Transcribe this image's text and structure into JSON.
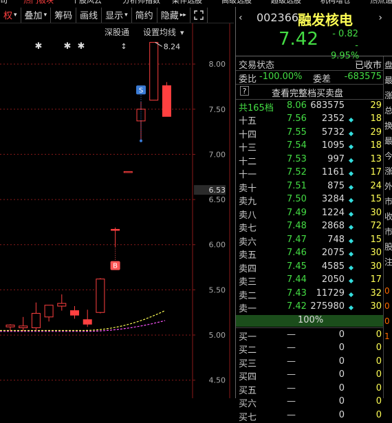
{
  "top_strip": [
    "司",
    "热门板块",
    "个股风云",
    "分析师指数",
    "某伴选股",
    "高级选股",
    "超级选股",
    "机构增仓",
    "热点追"
  ],
  "toolbar": {
    "items": [
      {
        "label": "权",
        "arrow": true,
        "color": "#ff4040"
      },
      {
        "label": "叠加",
        "arrow": true
      },
      {
        "label": "筹码"
      },
      {
        "label": "画线"
      },
      {
        "label": "显示",
        "arrow": true
      },
      {
        "label": "简约"
      },
      {
        "label": "隐藏",
        "arrow": "▸▸"
      },
      {
        "label": "fullscreen-icon"
      }
    ]
  },
  "chart": {
    "top_labels": {
      "shengu": "深股通",
      "ma_setting": "设置均线",
      "ma_arrow": "▾"
    },
    "price_axis": [
      "8.00",
      "7.50",
      "7.00",
      "6.50",
      "6.00",
      "5.50",
      "5.00",
      "4.50"
    ],
    "current_price_tag": "6.53",
    "high_label": "8.24",
    "markers": {
      "s": "S",
      "b": "B"
    },
    "colors": {
      "up": "#ff4040",
      "down": "#22cccc",
      "ma5": "#ffffff",
      "ma10": "#ffff55",
      "ma20": "#ff55ff",
      "grid": "#8b1a1a"
    }
  },
  "chart_data": {
    "type": "candlestick",
    "ylim": [
      4.3,
      8.45
    ],
    "candles": [
      {
        "o": 5.09,
        "h": 5.12,
        "l": 5.04,
        "c": 5.11
      },
      {
        "o": 5.08,
        "h": 5.2,
        "l": 5.04,
        "c": 5.1
      },
      {
        "o": 5.08,
        "h": 5.36,
        "l": 5.05,
        "c": 5.24
      },
      {
        "o": 5.2,
        "h": 5.28,
        "l": 5.15,
        "c": 5.33
      },
      {
        "o": 5.32,
        "h": 5.45,
        "l": 5.27,
        "c": 5.35
      },
      {
        "o": 5.27,
        "h": 5.32,
        "l": 5.18,
        "c": 5.22
      },
      {
        "o": 5.17,
        "h": 5.28,
        "l": 5.09,
        "c": 5.12
      },
      {
        "o": 5.25,
        "h": 5.63,
        "l": 5.24,
        "c": 5.62
      },
      {
        "o": 6.17,
        "h": 6.19,
        "l": 5.97,
        "c": 6.16
      },
      {
        "o": 6.81,
        "h": 6.81,
        "l": 6.81,
        "c": 6.81
      },
      {
        "o": 7.37,
        "h": 7.58,
        "l": 7.15,
        "c": 7.5
      },
      {
        "o": 7.6,
        "h": 8.24,
        "l": 7.6,
        "c": 8.24
      },
      {
        "o": 7.76,
        "h": 7.8,
        "l": 7.42,
        "c": 7.42
      }
    ]
  },
  "quote": {
    "nav_left": "‹",
    "code": "002366",
    "name": "融发核电",
    "nav_right": "›",
    "price": "7.42",
    "change": "- 0.82",
    "change_pct": "- 9.95%",
    "status_label": "交易状态",
    "status_value": "已收市",
    "ratio_label": "委比",
    "ratio_value": "-100.00%",
    "diff_label": "委差",
    "diff_value": "-683575",
    "full_book_button": "查看完整档买卖盘",
    "help_icon": "?",
    "total_label": "共165档",
    "total_price": "8.06",
    "total_vol": "683575",
    "total_cnt": "29",
    "progress_label": "100%",
    "progress_value": 1.0
  },
  "asks": [
    {
      "label": "十五",
      "price": "7.56",
      "vol": "2352",
      "cnt": "18"
    },
    {
      "label": "十四",
      "price": "7.55",
      "vol": "5732",
      "cnt": "29"
    },
    {
      "label": "十三",
      "price": "7.54",
      "vol": "1095",
      "cnt": "18"
    },
    {
      "label": "十二",
      "price": "7.53",
      "vol": "997",
      "cnt": "13"
    },
    {
      "label": "十一",
      "price": "7.52",
      "vol": "1161",
      "cnt": "17"
    },
    {
      "label": "卖十",
      "price": "7.51",
      "vol": "875",
      "cnt": "24"
    },
    {
      "label": "卖九",
      "price": "7.50",
      "vol": "3284",
      "cnt": "15"
    },
    {
      "label": "卖八",
      "price": "7.49",
      "vol": "1224",
      "cnt": "30"
    },
    {
      "label": "卖七",
      "price": "7.48",
      "vol": "2868",
      "cnt": "72"
    },
    {
      "label": "卖六",
      "price": "7.47",
      "vol": "748",
      "cnt": "15"
    },
    {
      "label": "卖五",
      "price": "7.46",
      "vol": "2075",
      "cnt": "30"
    },
    {
      "label": "卖四",
      "price": "7.45",
      "vol": "4585",
      "cnt": "30"
    },
    {
      "label": "卖三",
      "price": "7.44",
      "vol": "2050",
      "cnt": "17"
    },
    {
      "label": "卖二",
      "price": "7.43",
      "vol": "11729",
      "cnt": "32"
    },
    {
      "label": "卖一",
      "price": "7.42",
      "vol": "275980",
      "cnt": "30"
    }
  ],
  "bids": [
    {
      "label": "买一",
      "price": "—",
      "vol": "0",
      "cnt": "0"
    },
    {
      "label": "买二",
      "price": "—",
      "vol": "0",
      "cnt": "0"
    },
    {
      "label": "买三",
      "price": "—",
      "vol": "0",
      "cnt": "0"
    },
    {
      "label": "买四",
      "price": "—",
      "vol": "0",
      "cnt": "0"
    },
    {
      "label": "买五",
      "price": "—",
      "vol": "0",
      "cnt": "0"
    },
    {
      "label": "买六",
      "price": "—",
      "vol": "0",
      "cnt": "0"
    },
    {
      "label": "买七",
      "price": "—",
      "vol": "0",
      "cnt": "0"
    }
  ],
  "sidebar_chars": [
    "盘",
    "最",
    "涨",
    "总",
    "换",
    "最",
    "今",
    "涨",
    "外",
    "市",
    "收",
    "市",
    "股",
    "注",
    "",
    "0",
    "0",
    "0",
    "1"
  ]
}
